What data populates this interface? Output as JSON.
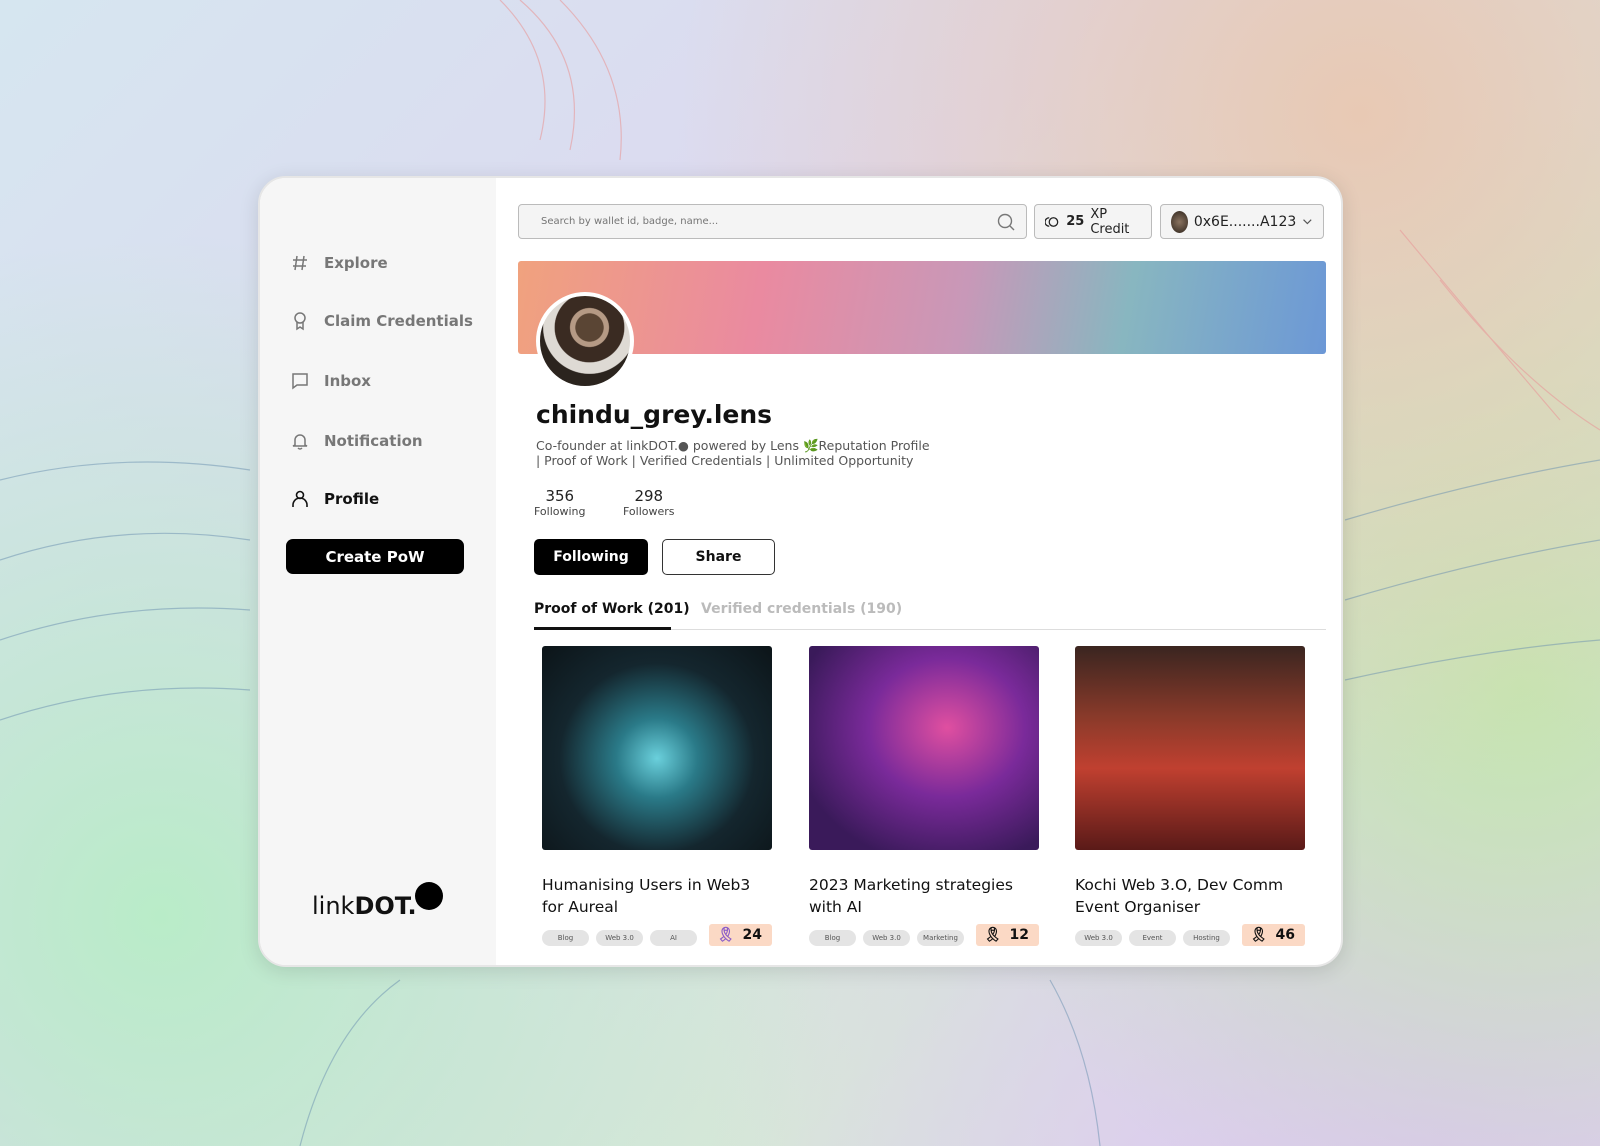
{
  "sidebar": {
    "items": [
      {
        "label": "Explore",
        "icon": "hash-icon"
      },
      {
        "label": "Claim Credentials",
        "icon": "award-icon"
      },
      {
        "label": "Inbox",
        "icon": "message-icon"
      },
      {
        "label": "Notification",
        "icon": "bell-icon"
      },
      {
        "label": "Profile",
        "icon": "user-icon",
        "active": true
      }
    ],
    "create_label": "Create PoW",
    "logo": "linkDOT."
  },
  "header": {
    "search_placeholder": "Search by wallet id, badge, name...",
    "xp_value": "25",
    "xp_label": "XP Credit",
    "wallet": "0x6E.......A123"
  },
  "profile": {
    "name": "chindu_grey.lens",
    "bio_line1": "Co-founder at linkDOT.● powered by Lens 🌿Reputation Profile",
    "bio_line2": "| Proof of Work | Verified Credentials | Unlimited Opportunity",
    "following_count": "356",
    "following_label": "Following",
    "followers_count": "298",
    "followers_label": "Followers",
    "follow_button": "Following",
    "share_button": "Share"
  },
  "tabs": [
    {
      "label": "Proof of Work (201)",
      "active": true
    },
    {
      "label": "Verified credentials (190)",
      "active": false
    }
  ],
  "cards": [
    {
      "title": "Humanising Users in Web3 for Aureal",
      "tags": [
        "Blog",
        "Web 3.0",
        "AI"
      ],
      "count": "24"
    },
    {
      "title": "2023 Marketing strategies with AI",
      "tags": [
        "Blog",
        "Web 3.0",
        "Marketing"
      ],
      "count": "12"
    },
    {
      "title": "Kochi Web 3.O, Dev Comm Event Organiser",
      "tags": [
        "Web 3.0",
        "Event",
        "Hosting"
      ],
      "count": "46"
    }
  ],
  "colors": {
    "accent": "#000000",
    "badge_bg": "#fbd9c5"
  }
}
